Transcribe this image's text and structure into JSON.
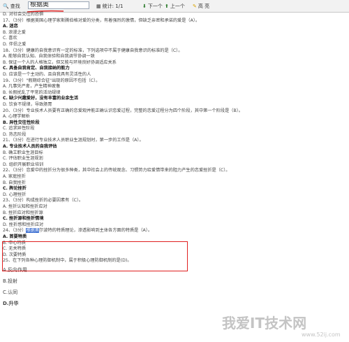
{
  "toolbar": {
    "find_label": "查找",
    "search_value": "根据奥",
    "stats": "统计: 1/1",
    "next": "下一个",
    "prev": "上一个",
    "highlight": "高 亮"
  },
  "lines": [
    {
      "text": "D. 对社会交往的恐惧",
      "bold": false
    },
    {
      "text": "17、（3分）根据美国心理学家斯腾伯格对爱的分类，有着强烈的激情，但缺乏亲密和承诺的爱是（A）。",
      "bold": false
    },
    {
      "text": "A. 迷恋",
      "bold": true
    },
    {
      "text": "B. 浪漫之爱",
      "bold": false
    },
    {
      "text": "C. 喜欢",
      "bold": false
    },
    {
      "text": "D. 伴侣之爱",
      "bold": false
    },
    {
      "text": "18、（3分）健康的自我意识有一定的标准，下列选项中不属于健康自我意识的标准的是（C）。",
      "bold": false
    },
    {
      "text": "A. 能够自我认知、自我体验和自我调节协调一致",
      "bold": false
    },
    {
      "text": "B. 保证一个人的人格独立，但又能与环境良好协调适应关系",
      "bold": false
    },
    {
      "text": "C. 具备自我肯定、自我接纳的能力",
      "bold": true
    },
    {
      "text": "D. 应该是一个主动的、且自我具有灵活性的人",
      "bold": false
    },
    {
      "text": "19、（3分）\"假期综合征\"出现的原因不包括（C）。",
      "bold": false
    },
    {
      "text": "A. 凡事凭严卑，产生精神疲惫",
      "bold": false
    },
    {
      "text": "B. 长假扰乱了平常的活动规律",
      "bold": false
    },
    {
      "text": "C. 缺少兴趣爱好，没有丰富的业余生活",
      "bold": true
    },
    {
      "text": "D. 饮食不规律，导致肠胃",
      "bold": false
    },
    {
      "text": "20、（3分）专业技术人员要有正确的恋爱观并能正确认识恋爱过程，完整的恋爱过程分为四个阶段，其中第一个阶段是（B）。",
      "bold": false
    },
    {
      "text": "A. 心理学解析",
      "bold": false
    },
    {
      "text": "B. 异性交往性阶段",
      "bold": true
    },
    {
      "text": "C. 追求异性阶段",
      "bold": false
    },
    {
      "text": "D. 热恋阶段",
      "bold": false
    },
    {
      "text": "21、（3分）在进行专业技术人员职业生涯规划时，第一步的工作是（A）。",
      "bold": false
    },
    {
      "text": "A. 专业技术人员的自我评估",
      "bold": true
    },
    {
      "text": "B. 确立职业生涯目标",
      "bold": false
    },
    {
      "text": "C. 评估职业生涯规划",
      "bold": false
    },
    {
      "text": "D. 组织开展职业培训",
      "bold": false
    },
    {
      "text": "22、（3分）恋爱中的挫折分为很多种类，其中社会上的传统观念、习惯势力给爱情带来的阻力产生的恋爱挫折是（C）。",
      "bold": false
    },
    {
      "text": "A. 家庭挫折",
      "bold": false
    },
    {
      "text": "B. 自我挫折",
      "bold": false
    },
    {
      "text": "C. 舆论挫折",
      "bold": true
    },
    {
      "text": "D. 心理挫折",
      "bold": false
    },
    {
      "text": "23、（3分）构成挫折的必要因素有（C）。",
      "bold": false
    },
    {
      "text": "A. 挫折认知和挫折应对",
      "bold": false
    },
    {
      "text": "B. 挫折应对和挫折源",
      "bold": false
    },
    {
      "text": "C. 挫折源和挫折情境",
      "bold": true
    },
    {
      "text": "D. 挫折感和挫折应对",
      "bold": false
    }
  ],
  "q24": {
    "prefix": "24、（3分）",
    "highlight": "根据奥",
    "rest": "尔波特的特质理论，渗透影响到主体各方面的特质是（A）。",
    "options": [
      {
        "text": "A. 首要特质",
        "bold": true
      },
      {
        "text": "B. 中心特质",
        "bold": false
      },
      {
        "text": "C. 无关特质",
        "bold": false
      },
      {
        "text": "D. 次要特质",
        "bold": false
      }
    ]
  },
  "q25": {
    "question": "25、在下列各种心理防御机制中，属于积极心理防御机制的是(D)。",
    "options": [
      {
        "text": "A.反向作用",
        "bold": false
      },
      {
        "text": "B.投射",
        "bold": false
      },
      {
        "text": "C.认同",
        "bold": false
      },
      {
        "text": "D.升华",
        "bold": true
      }
    ]
  },
  "watermark": {
    "text": "我爱IT技术网",
    "url": "www.52ij.com"
  }
}
